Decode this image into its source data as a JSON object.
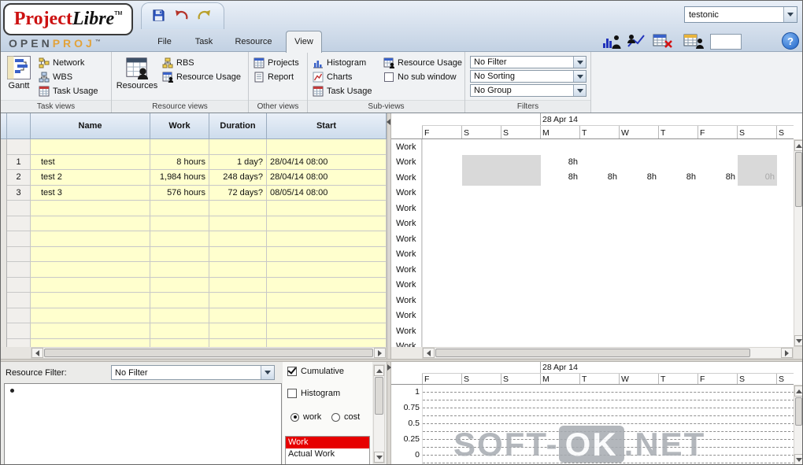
{
  "window": {
    "project_name": "testonic",
    "help_label": "?"
  },
  "logo": {
    "project": "Project",
    "libre": "Libre",
    "tm": "TM",
    "open": "OPEN",
    "proj": "PROJ",
    "openproj_tm": "™"
  },
  "tabs": {
    "file": "File",
    "task": "Task",
    "resource": "Resource",
    "view": "View"
  },
  "ribbon": {
    "task_views": {
      "label": "Task views",
      "gantt": "Gantt",
      "network": "Network",
      "wbs": "WBS",
      "task_usage": "Task Usage"
    },
    "resource_views": {
      "label": "Resource views",
      "resources": "Resources",
      "rbs": "RBS",
      "resource_usage": "Resource Usage"
    },
    "other_views": {
      "label": "Other views",
      "projects": "Projects",
      "report": "Report"
    },
    "sub_views": {
      "label": "Sub-views",
      "histogram": "Histogram",
      "charts": "Charts",
      "task_usage": "Task Usage",
      "resource_usage": "Resource Usage",
      "no_sub_window": "No sub window"
    },
    "filters": {
      "label": "Filters",
      "filter": "No Filter",
      "sorting": "No Sorting",
      "group": "No Group"
    }
  },
  "task_table": {
    "headers": {
      "name": "Name",
      "work": "Work",
      "duration": "Duration",
      "start": "Start"
    },
    "total_rows": 14,
    "rows": [
      {
        "row_index": 1,
        "num": "1",
        "name": "test",
        "work": "8 hours",
        "duration": "1 day?",
        "start": "28/04/14 08:00"
      },
      {
        "row_index": 2,
        "num": "2",
        "name": "test 2",
        "work": "1,984 hours",
        "duration": "248 days?",
        "start": "28/04/14 08:00"
      },
      {
        "row_index": 3,
        "num": "3",
        "name": "test 3",
        "work": "576 hours",
        "duration": "72 days?",
        "start": "08/05/14 08:00"
      }
    ]
  },
  "usage": {
    "week_label": "28 Apr 14",
    "days": [
      "F",
      "S",
      "S",
      "M",
      "T",
      "W",
      "T",
      "F",
      "S",
      "S"
    ],
    "row_label": "Work",
    "total_rows": 14,
    "shaded": {
      "rows": [
        1,
        2
      ],
      "columns": [
        1,
        2,
        8
      ]
    },
    "values": [
      {
        "row_index": 1,
        "cells": [
          {
            "col": 3,
            "text": "8h"
          }
        ]
      },
      {
        "row_index": 2,
        "cells": [
          {
            "col": 3,
            "text": "8h"
          },
          {
            "col": 4,
            "text": "8h"
          },
          {
            "col": 5,
            "text": "8h"
          },
          {
            "col": 6,
            "text": "8h"
          },
          {
            "col": 7,
            "text": "8h"
          },
          {
            "col": 8,
            "text": "0h",
            "muted": true
          }
        ]
      }
    ]
  },
  "histogram_controls": {
    "filter_label": "Resource Filter:",
    "filter_value": "No Filter",
    "cumulative": {
      "label": "Cumulative",
      "checked": true
    },
    "histogram": {
      "label": "Histogram",
      "checked": false
    },
    "metric": {
      "work": "work",
      "cost": "cost",
      "selected": "work"
    },
    "series": [
      {
        "label": "Work",
        "selected": true
      },
      {
        "label": "Actual Work",
        "selected": false
      }
    ]
  },
  "chart": {
    "week_label": "28 Apr 14",
    "days": [
      "F",
      "S",
      "S",
      "M",
      "T",
      "W",
      "T",
      "F",
      "S",
      "S"
    ],
    "y_ticks": [
      "1",
      "0.75",
      "0.5",
      "0.25",
      "0"
    ]
  },
  "watermark": {
    "pre": "SOFT-",
    "box": "OK",
    "post": ".NET"
  }
}
